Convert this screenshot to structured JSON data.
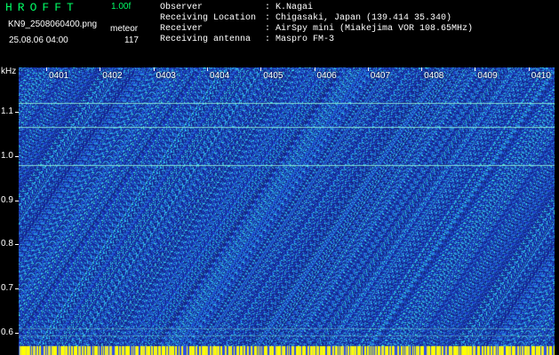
{
  "header": {
    "app_name": "HROFFT",
    "version": "1.00f",
    "file_name": "KN9_2508060400.png",
    "meteor_label": "meteor",
    "datetime": "25.08.06 04:00",
    "meteor_count": "117"
  },
  "info": [
    {
      "label": "Observer",
      "value": "K.Nagai"
    },
    {
      "label": "Receiving Location",
      "value": "Chigasaki, Japan (139.414 35.340)"
    },
    {
      "label": "Receiver",
      "value": "AirSpy mini (Miakejima VOR 108.65MHz)"
    },
    {
      "label": "Receiving antenna",
      "value": "Maspro FM-3"
    }
  ],
  "spectrogram": {
    "y_unit": "kHz",
    "y_ticks": [
      "1.1",
      "1.0",
      "0.9",
      "0.8",
      "0.7",
      "0.6"
    ],
    "y_tick_values": [
      1.1,
      1.0,
      0.9,
      0.8,
      0.7,
      0.6
    ],
    "y_range": [
      0.55,
      1.2
    ],
    "time_labels": [
      "0401",
      "0402",
      "0403",
      "0404",
      "0405",
      "0406",
      "0407",
      "0408",
      "0409",
      "0410"
    ],
    "horizontal_line_freqs": [
      1.12,
      1.065,
      0.98
    ],
    "colors": {
      "background": "#1a2a8a",
      "noise_low": "#2d4fd0",
      "noise_high": "#25d0d8",
      "line": "#8ff0d8",
      "bottom_band": "#ffff00"
    }
  }
}
